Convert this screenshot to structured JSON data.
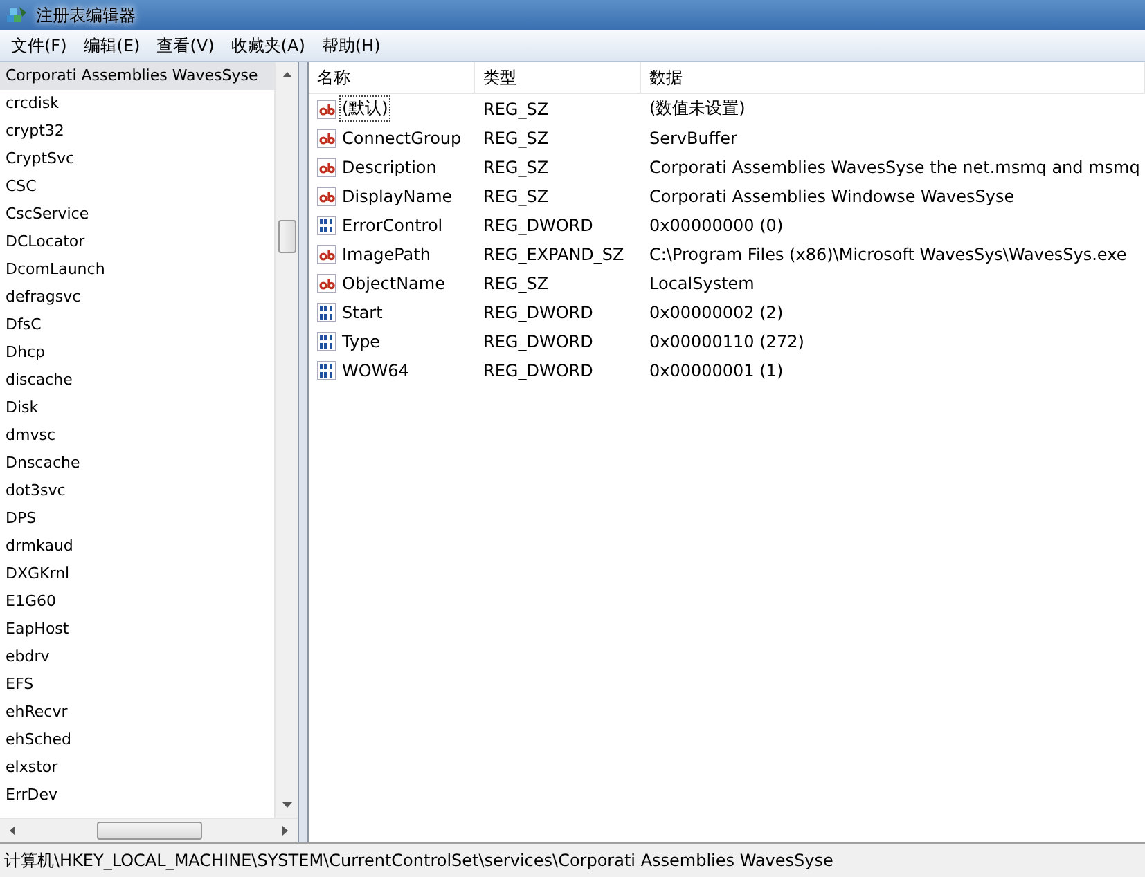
{
  "window": {
    "title": "注册表编辑器"
  },
  "menu": [
    "文件(F)",
    "编辑(E)",
    "查看(V)",
    "收藏夹(A)",
    "帮助(H)"
  ],
  "tree": [
    {
      "label": "Corporati Assemblies WavesSyse",
      "selected": true
    },
    {
      "label": "crcdisk",
      "selected": false
    },
    {
      "label": "crypt32",
      "selected": false
    },
    {
      "label": "CryptSvc",
      "selected": false
    },
    {
      "label": "CSC",
      "selected": false
    },
    {
      "label": "CscService",
      "selected": false
    },
    {
      "label": "DCLocator",
      "selected": false
    },
    {
      "label": "DcomLaunch",
      "selected": false
    },
    {
      "label": "defragsvc",
      "selected": false
    },
    {
      "label": "DfsC",
      "selected": false
    },
    {
      "label": "Dhcp",
      "selected": false
    },
    {
      "label": "discache",
      "selected": false
    },
    {
      "label": "Disk",
      "selected": false
    },
    {
      "label": "dmvsc",
      "selected": false
    },
    {
      "label": "Dnscache",
      "selected": false
    },
    {
      "label": "dot3svc",
      "selected": false
    },
    {
      "label": "DPS",
      "selected": false
    },
    {
      "label": "drmkaud",
      "selected": false
    },
    {
      "label": "DXGKrnl",
      "selected": false
    },
    {
      "label": "E1G60",
      "selected": false
    },
    {
      "label": "EapHost",
      "selected": false
    },
    {
      "label": "ebdrv",
      "selected": false
    },
    {
      "label": "EFS",
      "selected": false
    },
    {
      "label": "ehRecvr",
      "selected": false
    },
    {
      "label": "ehSched",
      "selected": false
    },
    {
      "label": "elxstor",
      "selected": false
    },
    {
      "label": "ErrDev",
      "selected": false
    }
  ],
  "table": {
    "columns": [
      "名称",
      "类型",
      "数据"
    ],
    "rows": [
      {
        "kind": "string",
        "name": "(默认)",
        "type": "REG_SZ",
        "data": "(数值未设置)",
        "selected": true
      },
      {
        "kind": "string",
        "name": "ConnectGroup",
        "type": "REG_SZ",
        "data": "ServBuffer",
        "selected": false
      },
      {
        "kind": "string",
        "name": "Description",
        "type": "REG_SZ",
        "data": "Corporati Assemblies WavesSyse the net.msmq and msmq",
        "selected": false
      },
      {
        "kind": "string",
        "name": "DisplayName",
        "type": "REG_SZ",
        "data": "Corporati Assemblies Windowse WavesSyse",
        "selected": false
      },
      {
        "kind": "dword",
        "name": "ErrorControl",
        "type": "REG_DWORD",
        "data": "0x00000000 (0)",
        "selected": false
      },
      {
        "kind": "string",
        "name": "ImagePath",
        "type": "REG_EXPAND_SZ",
        "data": "C:\\Program Files (x86)\\Microsoft WavesSys\\WavesSys.exe",
        "selected": false
      },
      {
        "kind": "string",
        "name": "ObjectName",
        "type": "REG_SZ",
        "data": "LocalSystem",
        "selected": false
      },
      {
        "kind": "dword",
        "name": "Start",
        "type": "REG_DWORD",
        "data": "0x00000002 (2)",
        "selected": false
      },
      {
        "kind": "dword",
        "name": "Type",
        "type": "REG_DWORD",
        "data": "0x00000110 (272)",
        "selected": false
      },
      {
        "kind": "dword",
        "name": "WOW64",
        "type": "REG_DWORD",
        "data": "0x00000001 (1)",
        "selected": false
      }
    ]
  },
  "status_bar": "计算机\\HKEY_LOCAL_MACHINE\\SYSTEM\\CurrentControlSet\\services\\Corporati Assemblies WavesSyse"
}
